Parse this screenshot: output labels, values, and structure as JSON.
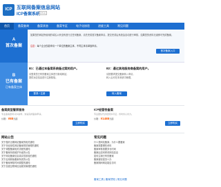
{
  "header": {
    "logo": "ICP",
    "title": "互联网备案信息网站",
    "subtitle": "ICP备案系统",
    "version": "(V5.0)"
  },
  "nav": [
    {
      "label": "首页",
      "active": true
    },
    {
      "label": "备案查询"
    },
    {
      "label": "备案状态"
    },
    {
      "label": "备案专区"
    },
    {
      "label": "电子化核验"
    },
    {
      "label": "进度工具"
    },
    {
      "label": "常见问题"
    }
  ],
  "steps": {
    "s1": {
      "num": "A",
      "title": "首次备案",
      "sub": "首次备案"
    },
    "s2": {
      "num": "B",
      "title": "已有备案",
      "sub": "已有备案主体"
    }
  },
  "panel1": {
    "intro": "如果您的网站所使用的域名从来没有进行过任何备案，请先完成首次备案申请。提交完成后系统会自动进行审核，如果您的资料无误即可完成备案。",
    "note_prefix": "注意：",
    "note": "每个企业仅能申请一个单位的备案主体，不同主体请单独申请。",
    "button": "首次备案入口"
  },
  "panel2": {
    "cardA": {
      "title": "B1：已通过本备案系统备过案的用户。",
      "lines": [
        "请登录您已有的备案主体进行新增网站，",
        "提供对应信息进行注册核验。"
      ],
      "button": "登录 / 注册"
    },
    "cardB": {
      "title": "B2：通过其他服务商备案的用户。",
      "lines": [
        "请按要求提交备案转入申请，",
        "转入后可在本系统中管理。"
      ],
      "button": "转入备案"
    }
  },
  "products": {
    "p1": {
      "title": "备案类型管家服务",
      "desc": "专业备案顾问1对1指导，快速完成备案申请。",
      "price_label": "价格：",
      "price": "¥88",
      "price_unit": "元起",
      "button": "立即购买"
    },
    "p2": {
      "title": "ICP经营性备案",
      "desc": "专业团队代办经营许可证，省时省心省力。",
      "price_label": "价格：",
      "price": "¥1488",
      "price_unit": "元起",
      "button": "立即购买"
    }
  },
  "news": {
    "title": "网站公告",
    "items": [
      "关于做好近期网站备案的相关通知",
      "关于非经营性网站备案规范管理的通知",
      "关于调整备案相关流程的通知",
      "关于备案系统维护升级的公告",
      "关于网站备案信息真实性核验的通知",
      "关于启用新版备案系统的公告",
      "关于备案审核时间调整的通知",
      "关于加强互联网信息服务管理的通知"
    ]
  },
  "help": {
    "title": "常见问题",
    "items": [
      "什么是网站备案，为什么要备案",
      "备案需要哪些资料",
      "备案审核需要多长时间",
      "备案后如何修改网站信息",
      "如何注销已有的备案",
      "备案被驳回怎么办",
      "备案期间网站能否访问"
    ],
    "more": "备案工具  |  备案须知  |  常见问题"
  }
}
